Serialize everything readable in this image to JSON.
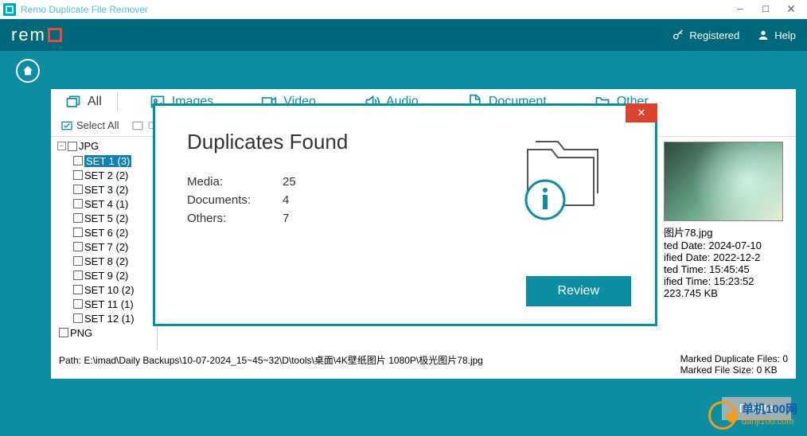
{
  "window": {
    "title": "Remo Duplicate File Remover"
  },
  "brand": {
    "logo_text": "rem",
    "registered": "Registered",
    "help": "Help"
  },
  "tabs": {
    "all": "All",
    "images": "Images",
    "video": "Video",
    "audio": "Audio",
    "document": "Document",
    "other": "Other"
  },
  "toolbar": {
    "select_all": "Select All",
    "de": "De"
  },
  "tree": {
    "cat_top": "JPG",
    "items": [
      {
        "label": "SET 1 (3)",
        "selected": true
      },
      {
        "label": "SET 2 (2)"
      },
      {
        "label": "SET 3 (2)"
      },
      {
        "label": "SET 4 (1)"
      },
      {
        "label": "SET 5 (2)"
      },
      {
        "label": "SET 6 (2)"
      },
      {
        "label": "SET 7 (2)"
      },
      {
        "label": "SET 8 (2)"
      },
      {
        "label": "SET 9 (2)"
      },
      {
        "label": "SET 10 (2)"
      },
      {
        "label": "SET 11 (1)"
      },
      {
        "label": "SET 12 (1)"
      }
    ],
    "cat_bottom": "PNG"
  },
  "preview": {
    "filename": "图片78.jpg",
    "created": "ted Date: 2024-07-10",
    "modified": "ified Date: 2022-12-2",
    "ctime": "ted Time: 15:45:45",
    "mtime": "ified Time: 15:23:52",
    "size": "223.745 KB"
  },
  "footer": {
    "path_label": "Path:",
    "path": "E:\\imad\\Daily Backups\\10-07-2024_15~45~32\\D\\tools\\桌面\\4K壁纸图片 1080P\\极光图片78.jpg",
    "marked_files_label": "Marked Duplicate Files:",
    "marked_files": "0",
    "marked_size_label": "Marked File Size:",
    "marked_size": "0",
    "size_unit": "KB"
  },
  "delete_btn": "Delete",
  "dialog": {
    "title": "Duplicates Found",
    "media_label": "Media:",
    "media": "25",
    "docs_label": "Documents:",
    "docs": "4",
    "others_label": "Others:",
    "others": "7",
    "review": "Review"
  },
  "watermark": {
    "line1": "单机100网",
    "line2": "danji100.com"
  }
}
